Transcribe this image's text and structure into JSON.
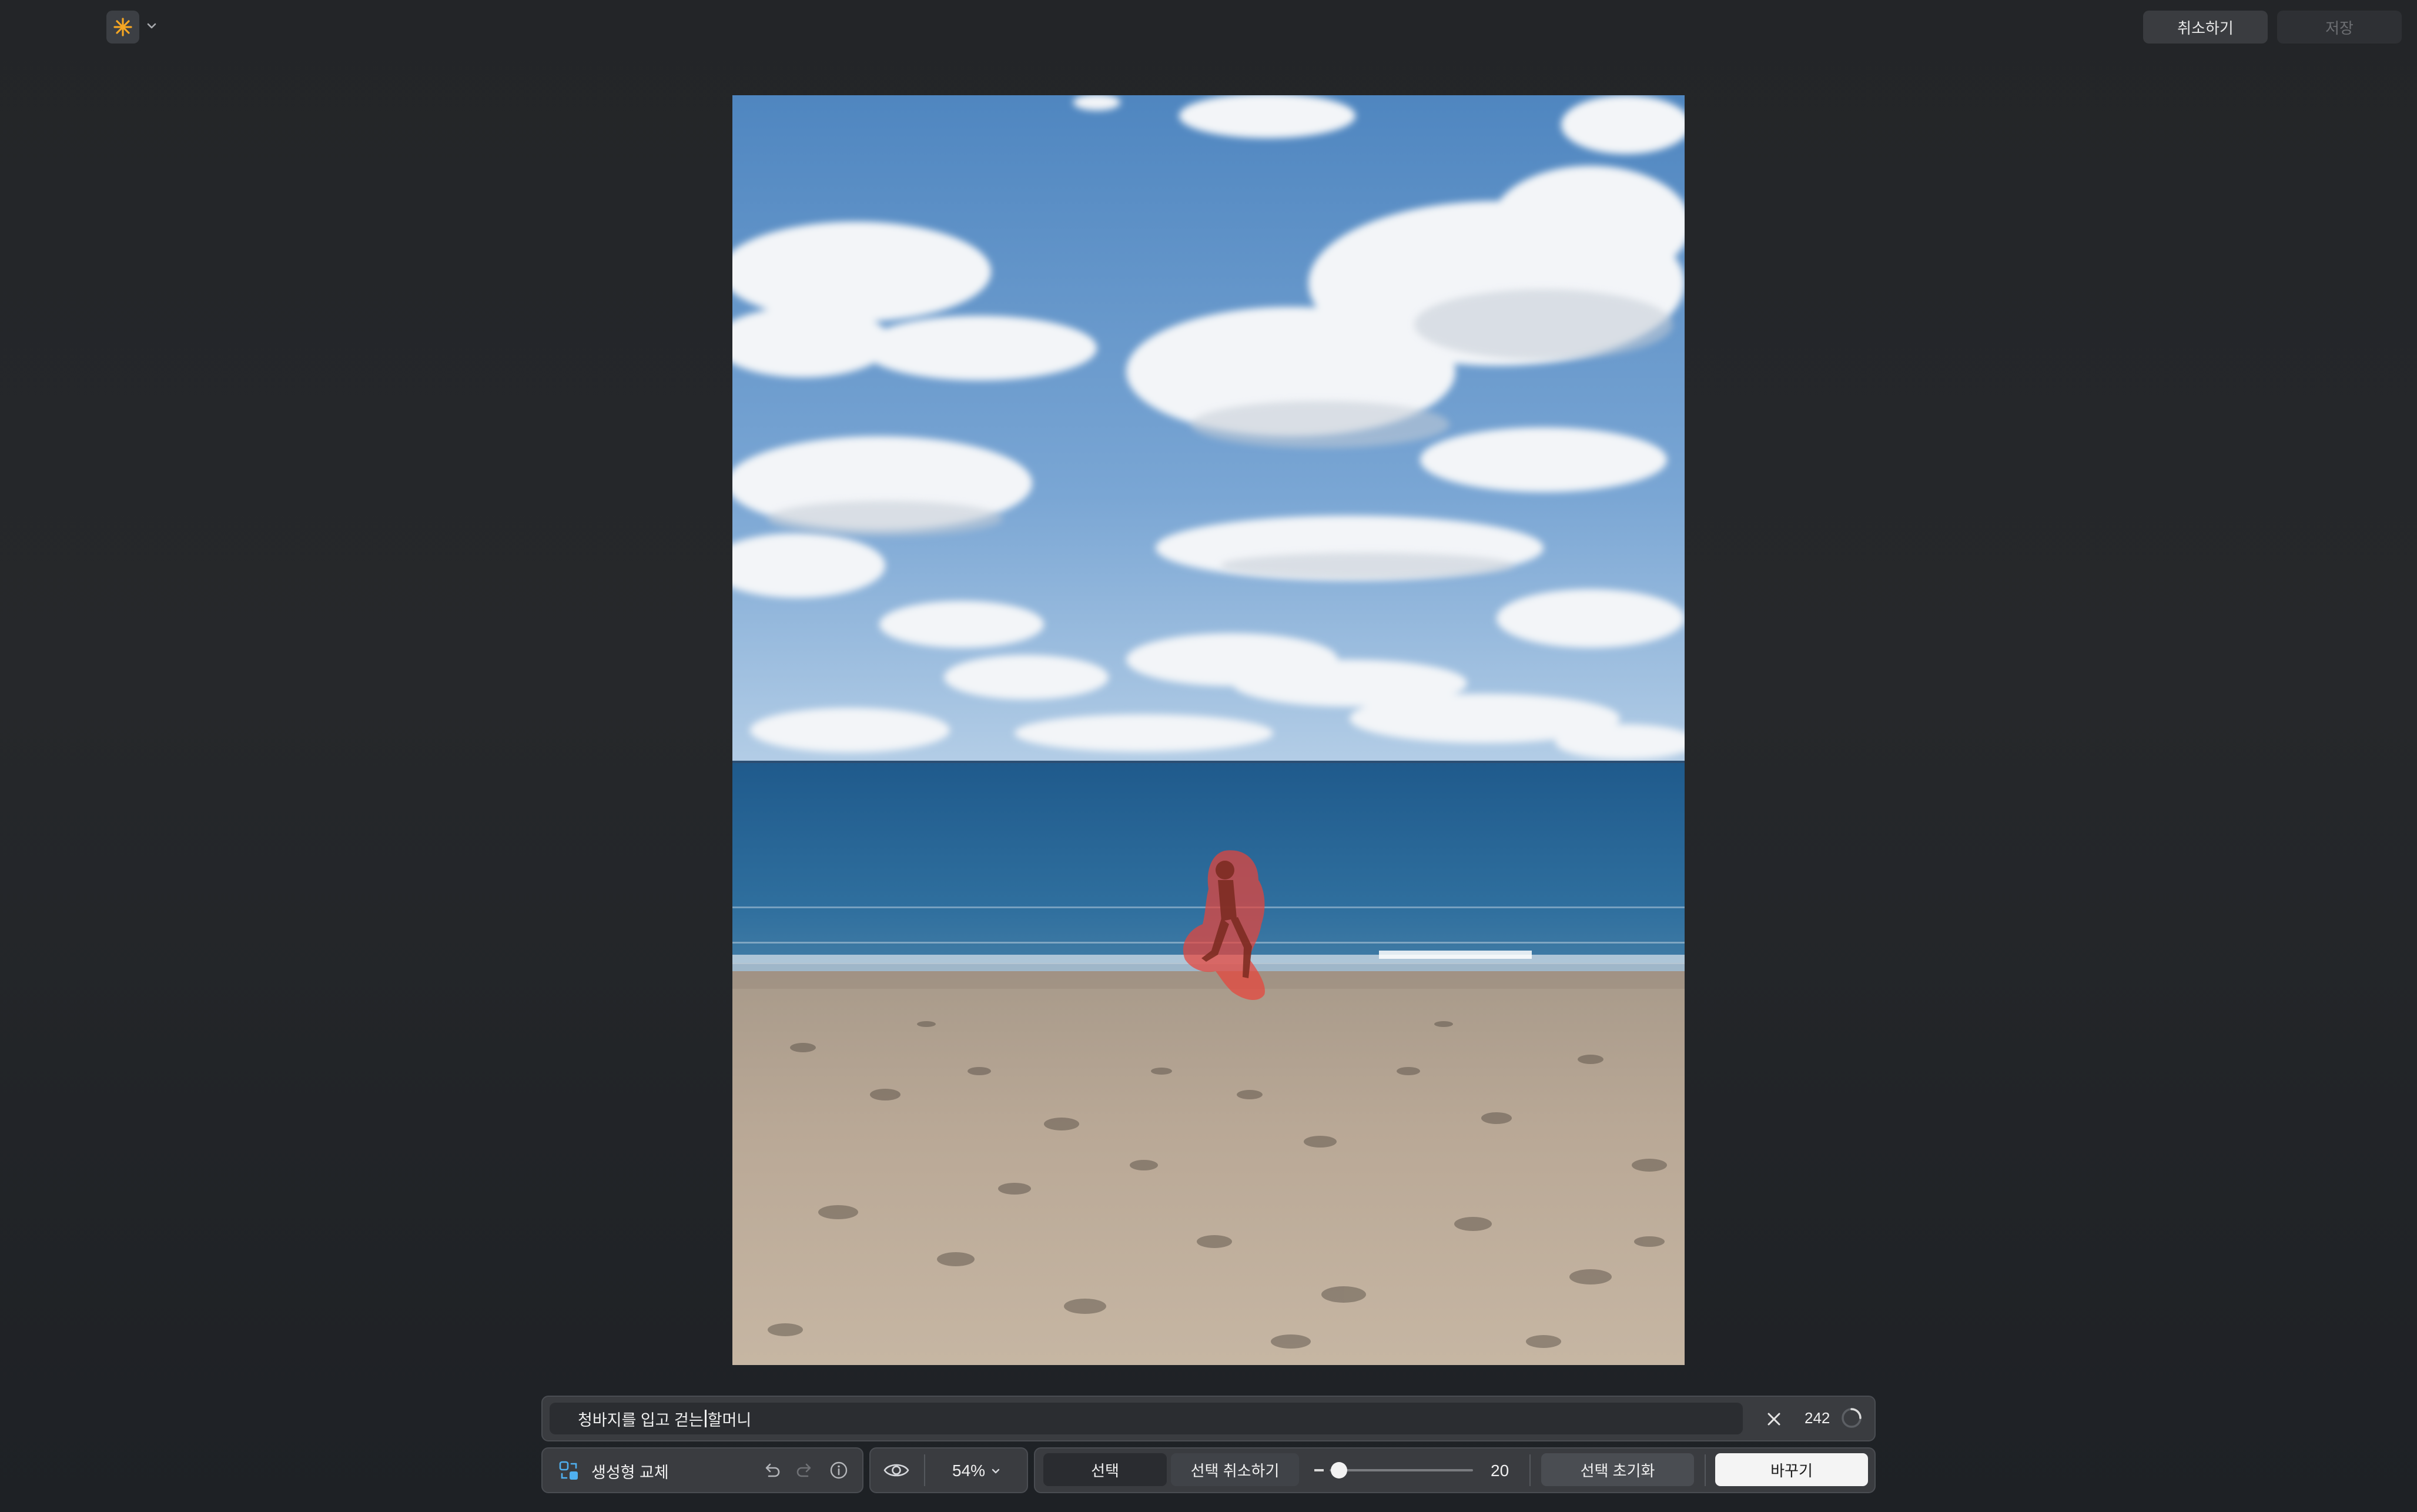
{
  "app": {
    "icon": "sparkle-icon",
    "accent_color": "#f5a623"
  },
  "header": {
    "cancel_label": "취소하기",
    "save_label": "저장"
  },
  "prompt": {
    "text_before_caret": "청바지를 입고 걷는",
    "text_after_caret": "할머니",
    "char_count": "242"
  },
  "toolbar": {
    "tool_label": "생성형 교체",
    "zoom": "54%",
    "select_label": "선택",
    "deselect_label": "선택 취소하기",
    "brush_size": "20",
    "reset_selection_label": "선택 초기화",
    "replace_label": "바꾸기"
  },
  "colors": {
    "selection_mask": "#e8443a",
    "primary_button": "#f4f4f4"
  }
}
